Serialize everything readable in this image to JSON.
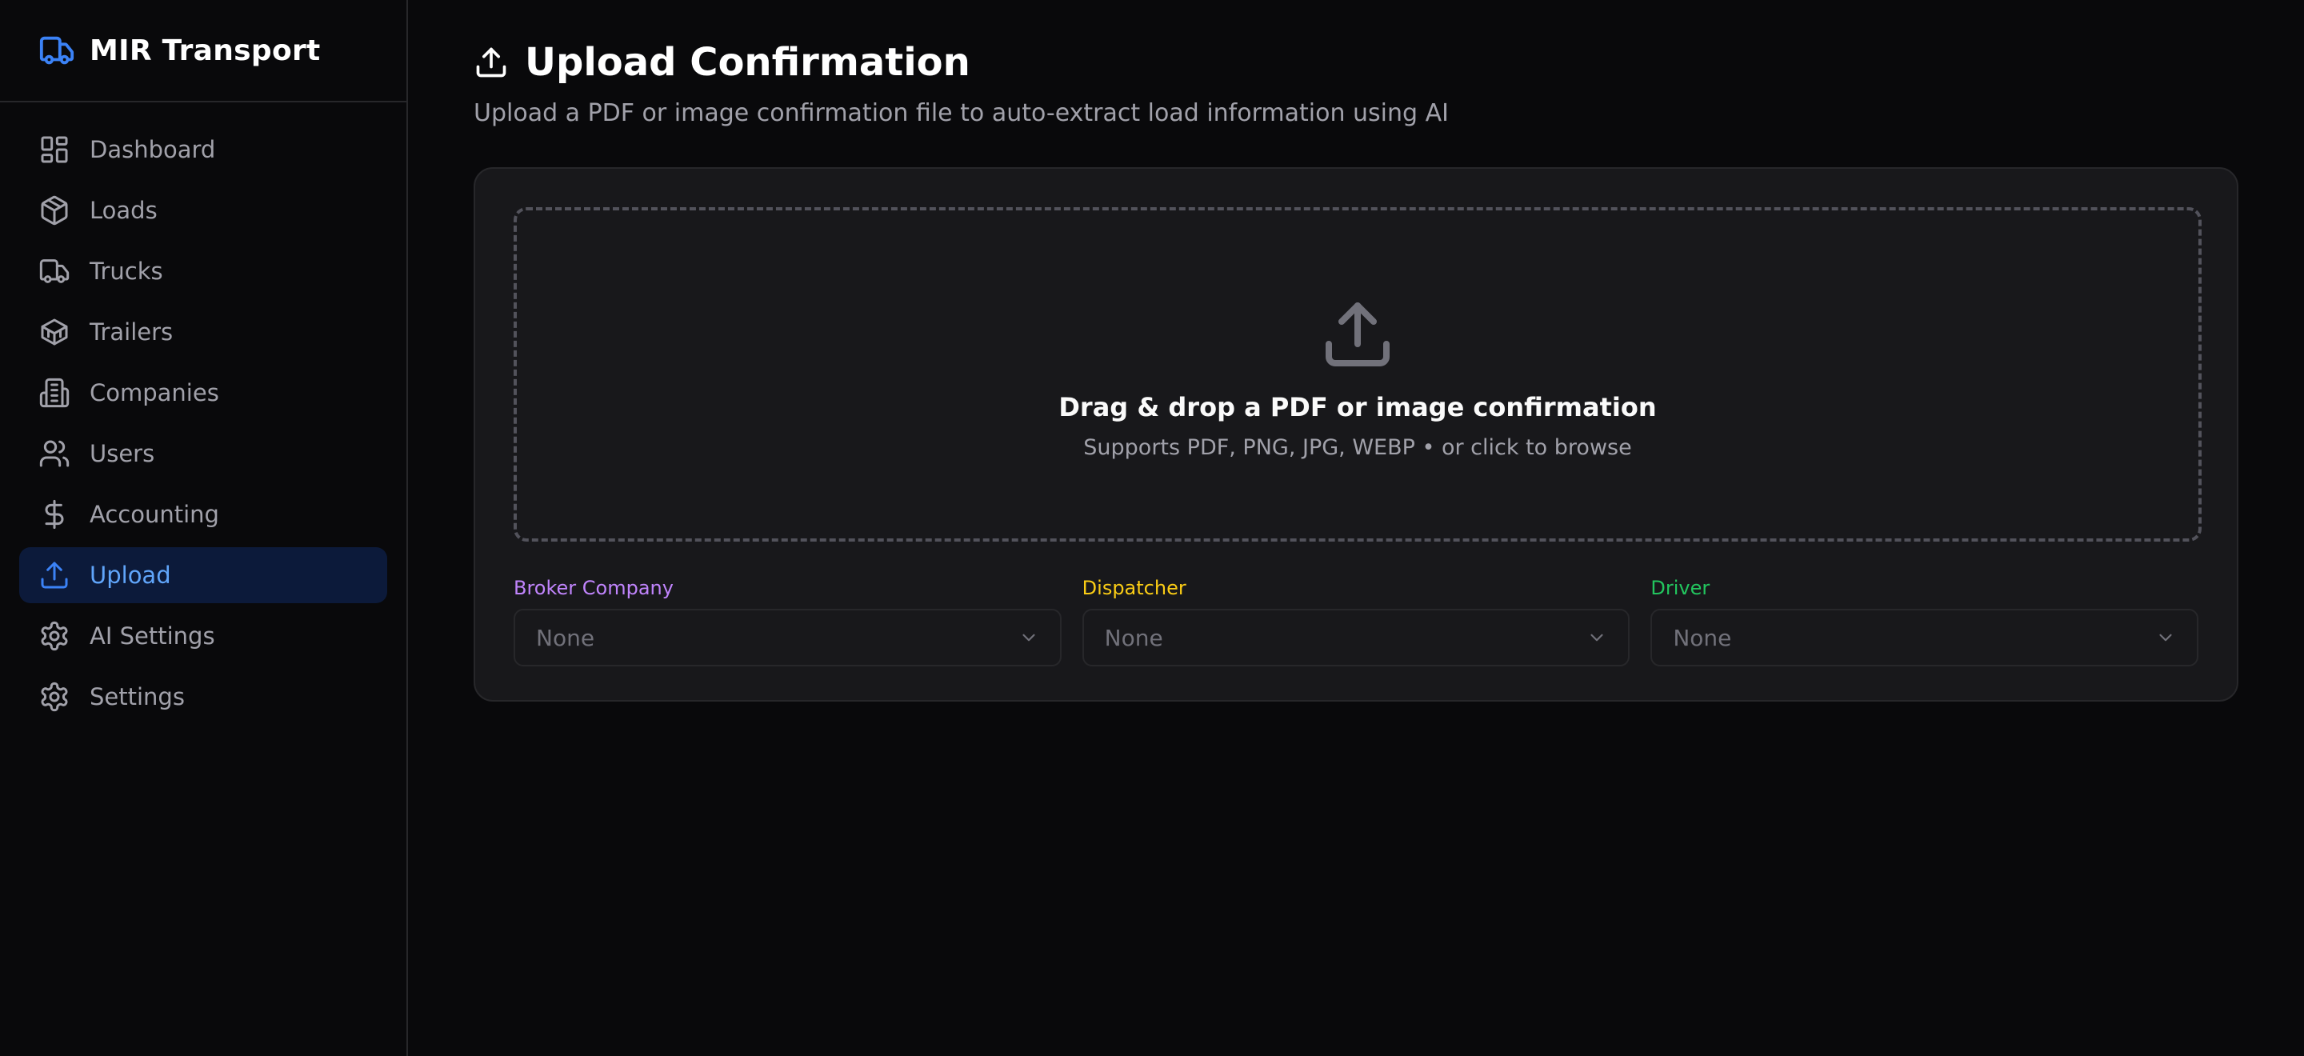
{
  "brand": {
    "name": "MIR Transport",
    "icon": "truck-icon",
    "color": "#3b82f6"
  },
  "sidebar": {
    "items": [
      {
        "label": "Dashboard",
        "icon": "dashboard-icon",
        "active": false
      },
      {
        "label": "Loads",
        "icon": "package-icon",
        "active": false
      },
      {
        "label": "Trucks",
        "icon": "truck-icon",
        "active": false
      },
      {
        "label": "Trailers",
        "icon": "boxes-icon",
        "active": false
      },
      {
        "label": "Companies",
        "icon": "building-icon",
        "active": false
      },
      {
        "label": "Users",
        "icon": "users-icon",
        "active": false
      },
      {
        "label": "Accounting",
        "icon": "dollar-icon",
        "active": false
      },
      {
        "label": "Upload",
        "icon": "upload-icon",
        "active": true
      },
      {
        "label": "AI Settings",
        "icon": "gear-icon",
        "active": false
      },
      {
        "label": "Settings",
        "icon": "gear-icon",
        "active": false
      }
    ]
  },
  "page": {
    "title": "Upload Confirmation",
    "subtitle": "Upload a PDF or image confirmation file to auto-extract load information using AI"
  },
  "dropzone": {
    "title": "Drag & drop a PDF or image confirmation",
    "subtitle": "Supports PDF, PNG, JPG, WEBP • or click to browse"
  },
  "selects": {
    "broker": {
      "label": "Broker Company",
      "value": "None",
      "color": "#c084fc"
    },
    "dispatcher": {
      "label": "Dispatcher",
      "value": "None",
      "color": "#facc15"
    },
    "driver": {
      "label": "Driver",
      "value": "None",
      "color": "#22c55e"
    }
  },
  "colors": {
    "accent": "#3b82f6",
    "active_bg": "#0c1a3a",
    "active_text": "#60a5fa"
  }
}
